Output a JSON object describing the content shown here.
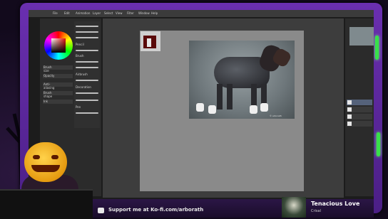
{
  "app": {
    "menu_items": [
      "File",
      "Edit",
      "Animation",
      "Layer",
      "Select",
      "View",
      "Filter",
      "Window",
      "Help"
    ]
  },
  "tool_panel": {
    "labels": [
      "Pencil",
      "Brush",
      "Airbrush",
      "Decoration",
      "Pen"
    ],
    "property_labels": [
      "Brush size",
      "Opacity",
      "Anti-aliasing",
      "Brush shape",
      "Ink"
    ]
  },
  "canvas": {
    "photo_caption": "© arborath"
  },
  "bottom_bar": {
    "support_text": "Support me at Ko-fi.com/arborath",
    "song_title": "Tenacious Love",
    "song_artist": "Crisal"
  },
  "colors": {
    "frame": "#6a2fb0",
    "accent_slime": "#38e04a",
    "primary_color": "#e01010"
  }
}
